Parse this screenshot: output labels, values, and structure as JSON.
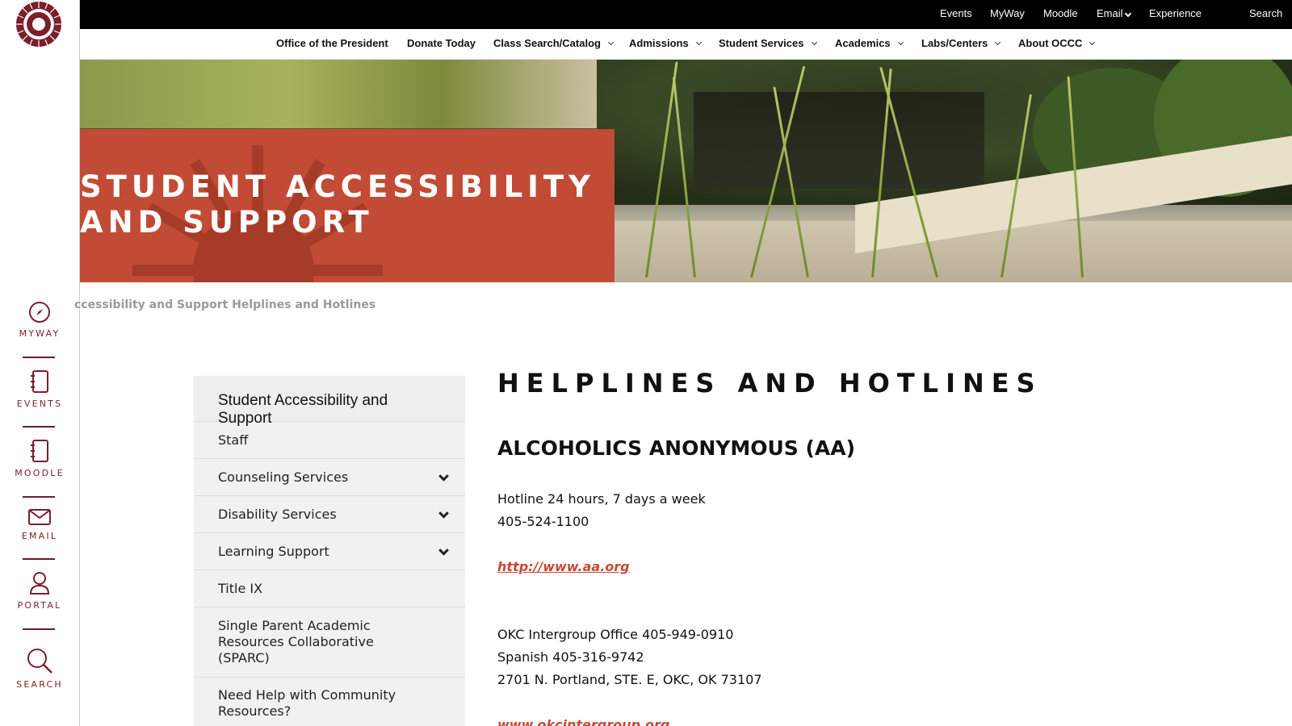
{
  "rail": {
    "items": [
      {
        "label": "MYWAY",
        "icon": "compass-icon"
      },
      {
        "label": "EVENTS",
        "icon": "notebook-icon"
      },
      {
        "label": "MOODLE",
        "icon": "notebook-icon"
      },
      {
        "label": "EMAIL",
        "icon": "envelope-icon"
      },
      {
        "label": "PORTAL",
        "icon": "user-icon"
      },
      {
        "label": "SEARCH",
        "icon": "search-icon"
      }
    ]
  },
  "topbar": {
    "links": [
      "Events",
      "MyWay",
      "Moodle",
      "Email",
      "Experience",
      "Search"
    ]
  },
  "mainnav": {
    "items": [
      "Office of the President",
      "Donate Today",
      "Class Search/Catalog",
      "Admissions",
      "Student Services",
      "Academics",
      "Labs/Centers",
      "About OCCC"
    ]
  },
  "hero": {
    "title_line1": "STUDENT ACCESSIBILITY",
    "title_line2": "AND SUPPORT"
  },
  "breadcrumb": "ccessibility and Support Helplines and Hotlines",
  "sidemenu": {
    "heading": "Student Accessibility and Support",
    "items": [
      {
        "label": "Staff",
        "expandable": false
      },
      {
        "label": "Counseling Services",
        "expandable": true
      },
      {
        "label": "Disability Services",
        "expandable": true
      },
      {
        "label": "Learning Support",
        "expandable": true
      },
      {
        "label": "Title IX",
        "expandable": false
      },
      {
        "label": "Single Parent Academic Resources Collaborative (SPARC)",
        "expandable": false
      },
      {
        "label": "Need Help with Community Resources?",
        "expandable": false
      }
    ]
  },
  "content": {
    "page_title": "HELPLINES AND HOTLINES",
    "section_title": "ALCOHOLICS ANONYMOUS (AA)",
    "hotline_hours": "Hotline 24 hours, 7 days a week",
    "hotline_phone": "405-524-1100",
    "aa_link": "http://www.aa.org",
    "intergroup_office": "OKC Intergroup Office 405-949-0910",
    "spanish_line": "Spanish 405-316-9742",
    "address": "2701 N. Portland, STE. E, OKC, OK 73107",
    "intergroup_link": "www.okcintergroup.org"
  },
  "colors": {
    "brand_maroon": "#7a1f2b",
    "hero_red": "#c24b35",
    "link_red": "#c24b35",
    "sidemenu_bg": "#f1f1ef"
  }
}
